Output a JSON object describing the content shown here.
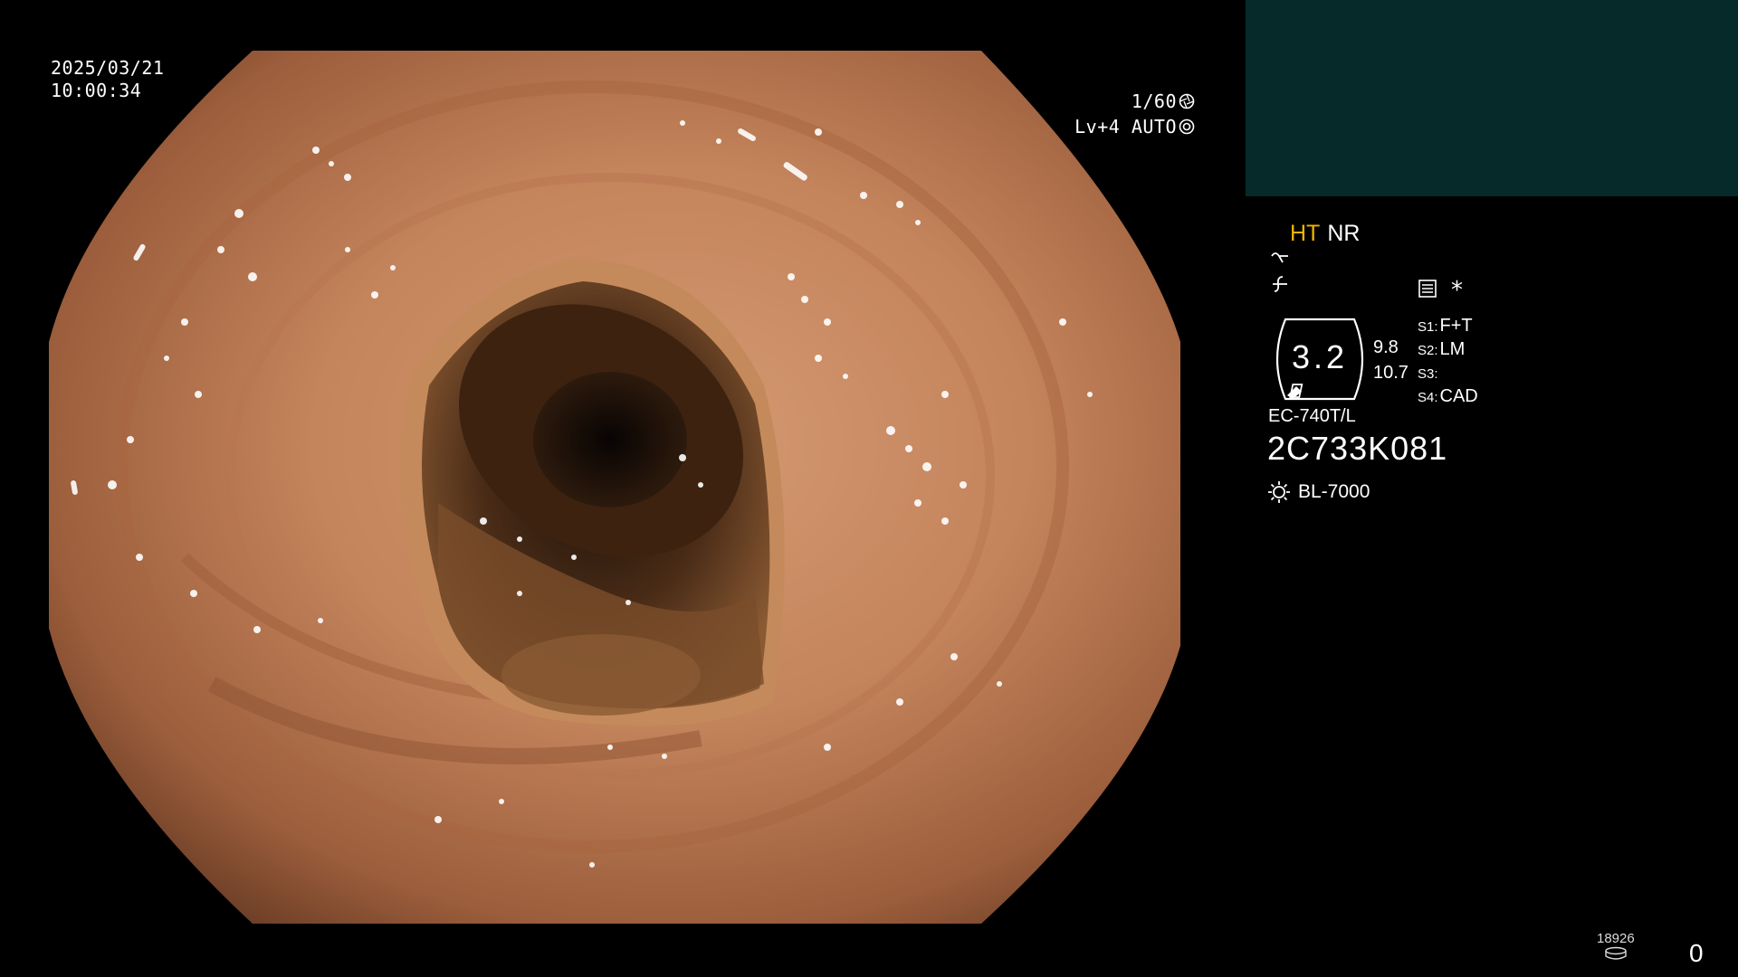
{
  "datetime": {
    "date": "2025/03/21",
    "time": "10:00:34"
  },
  "exposure": {
    "shutter": "1/60",
    "level": "Lv+4 AUTO"
  },
  "mode": {
    "ht": "HT",
    "nr": "NR"
  },
  "gauge": {
    "value": "3.2",
    "side_top": "9.8",
    "side_bottom": "10.7"
  },
  "scope_settings": [
    {
      "key": "S1:",
      "value": "F+T"
    },
    {
      "key": "S2:",
      "value": "LM"
    },
    {
      "key": "S3:",
      "value": ""
    },
    {
      "key": "S4:",
      "value": "CAD"
    }
  ],
  "scope": {
    "model": "EC-740T/L",
    "serial": "2C733K081"
  },
  "light_source": "BL-7000",
  "storage": {
    "count_small": "18926",
    "count": "0"
  },
  "colors": {
    "ht_accent": "#f0b500",
    "thumbnail_bg": "#062a2a"
  }
}
